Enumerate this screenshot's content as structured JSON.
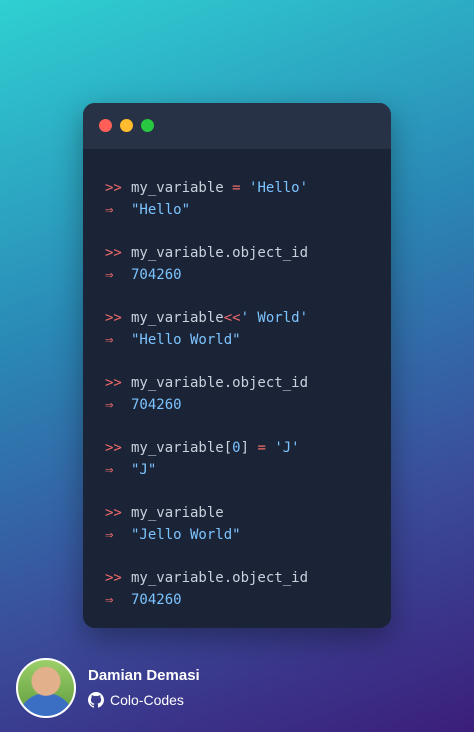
{
  "code_lines": [
    {
      "prompt": ">>",
      "parts": [
        {
          "t": "my_variable ",
          "c": "txt"
        },
        {
          "t": "=",
          "c": "op"
        },
        {
          "t": " ",
          "c": "txt"
        },
        {
          "t": "'Hello'",
          "c": "str"
        }
      ],
      "result": "\"Hello\""
    },
    {
      "prompt": ">>",
      "parts": [
        {
          "t": "my_variable.object_id",
          "c": "txt"
        }
      ],
      "result": "704260"
    },
    {
      "prompt": ">>",
      "parts": [
        {
          "t": "my_variable",
          "c": "txt"
        },
        {
          "t": "<<",
          "c": "op"
        },
        {
          "t": "' World'",
          "c": "str"
        }
      ],
      "result": "\"Hello World\""
    },
    {
      "prompt": ">>",
      "parts": [
        {
          "t": "my_variable.object_id",
          "c": "txt"
        }
      ],
      "result": "704260"
    },
    {
      "prompt": ">>",
      "parts": [
        {
          "t": "my_variable[",
          "c": "txt"
        },
        {
          "t": "0",
          "c": "num"
        },
        {
          "t": "] ",
          "c": "txt"
        },
        {
          "t": "=",
          "c": "op"
        },
        {
          "t": " ",
          "c": "txt"
        },
        {
          "t": "'J'",
          "c": "str"
        }
      ],
      "result": "\"J\""
    },
    {
      "prompt": ">>",
      "parts": [
        {
          "t": "my_variable",
          "c": "txt"
        }
      ],
      "result": "\"Jello World\""
    },
    {
      "prompt": ">>",
      "parts": [
        {
          "t": "my_variable.object_id",
          "c": "txt"
        }
      ],
      "result": "704260"
    }
  ],
  "result_arrow": "⇒",
  "author": {
    "name": "Damian Demasi",
    "handle": "Colo-Codes",
    "icon": "github-icon"
  },
  "colors": {
    "window_bg": "#1b2436",
    "prompt_red": "#ef6b6b",
    "string_blue": "#7cc4ff",
    "code_text": "#c9d1dd"
  }
}
